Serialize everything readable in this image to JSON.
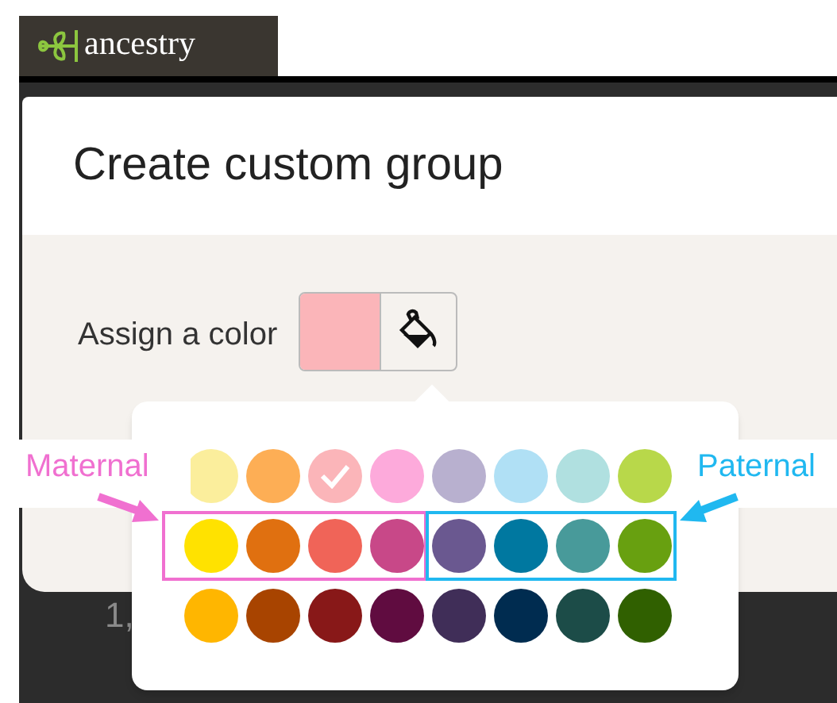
{
  "logo": {
    "text": "ancestry"
  },
  "dialog": {
    "title": "Create custom group",
    "color_label": "Assign a color",
    "current_swatch": {
      "color": "#fbb5b9"
    }
  },
  "background_text": "1,",
  "palette": [
    [
      {
        "color": "#fbee9c",
        "selected": false
      },
      {
        "color": "#fdae55",
        "selected": false
      },
      {
        "color": "#fbb5b9",
        "selected": true
      },
      {
        "color": "#fdaadb",
        "selected": false
      },
      {
        "color": "#b8b0cf",
        "selected": false
      },
      {
        "color": "#b0e0f5",
        "selected": false
      },
      {
        "color": "#b0e0e0",
        "selected": false
      },
      {
        "color": "#b8d84a",
        "selected": false
      }
    ],
    [
      {
        "color": "#ffe200",
        "selected": false
      },
      {
        "color": "#e07010",
        "selected": false
      },
      {
        "color": "#f06458",
        "selected": false
      },
      {
        "color": "#c84888",
        "selected": false
      },
      {
        "color": "#6a5890",
        "selected": false
      },
      {
        "color": "#0078a0",
        "selected": false
      },
      {
        "color": "#489a9a",
        "selected": false
      },
      {
        "color": "#68a010",
        "selected": false
      }
    ],
    [
      {
        "color": "#ffb600",
        "selected": false
      },
      {
        "color": "#a84400",
        "selected": false
      },
      {
        "color": "#881818",
        "selected": false
      },
      {
        "color": "#600c40",
        "selected": false
      },
      {
        "color": "#402e58",
        "selected": false
      },
      {
        "color": "#002c50",
        "selected": false
      },
      {
        "color": "#1c4c48",
        "selected": false
      },
      {
        "color": "#306000",
        "selected": false
      }
    ]
  ],
  "annotations": [
    {
      "label": "Maternal",
      "color": "#f070d0"
    },
    {
      "label": "Paternal",
      "color": "#20b8f0"
    }
  ]
}
